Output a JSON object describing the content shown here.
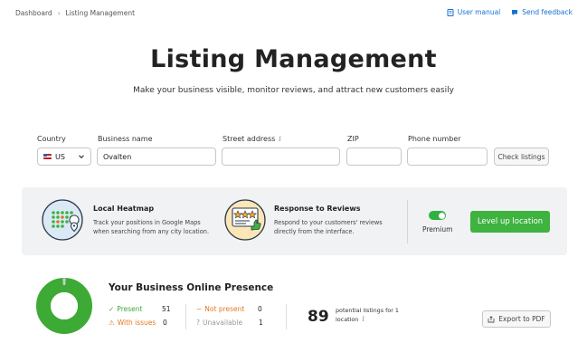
{
  "breadcrumb": {
    "root": "Dashboard",
    "current": "Listing Management"
  },
  "toplinks": {
    "manual": "User manual",
    "feedback": "Send feedback"
  },
  "page": {
    "title": "Listing Management",
    "subtitle": "Make your business visible, monitor reviews, and attract new customers easily"
  },
  "form": {
    "country_label": "Country",
    "country_value": "US",
    "business_label": "Business name",
    "business_value": "Ovalten",
    "street_label": "Street address",
    "street_info": "i",
    "zip_label": "ZIP",
    "phone_label": "Phone number",
    "check_button": "Check listings"
  },
  "promo": {
    "heatmap_title": "Local Heatmap",
    "heatmap_text_1": "Track your positions in Google Maps",
    "heatmap_text_2": "when searching from any city location.",
    "reviews_title": "Response to Reviews",
    "reviews_text_1": "Respond to your customers' reviews",
    "reviews_text_2": "directly from the interface.",
    "premium_label": "Premium",
    "level_up_button": "Level up location"
  },
  "presence": {
    "title": "Your Business Online Presence",
    "present_label": "Present",
    "present_count": "51",
    "issues_label": "With issues",
    "issues_count": "0",
    "not_present_label": "Not present",
    "not_present_count": "0",
    "unavailable_label": "Unavailable",
    "unavailable_count": "1",
    "potential_count": "89",
    "potential_text_1": "potential listings for 1",
    "potential_text_2": "location",
    "potential_info": "i",
    "export_button": "Export to PDF"
  },
  "colors": {
    "accent_green": "#3eb33f",
    "link_blue": "#1a6fd3",
    "warning_orange": "#e07a1f",
    "donut_green": "#3daa35"
  },
  "donut_data": {
    "present": 51,
    "with_issues": 0,
    "not_present": 0,
    "unavailable": 1
  }
}
